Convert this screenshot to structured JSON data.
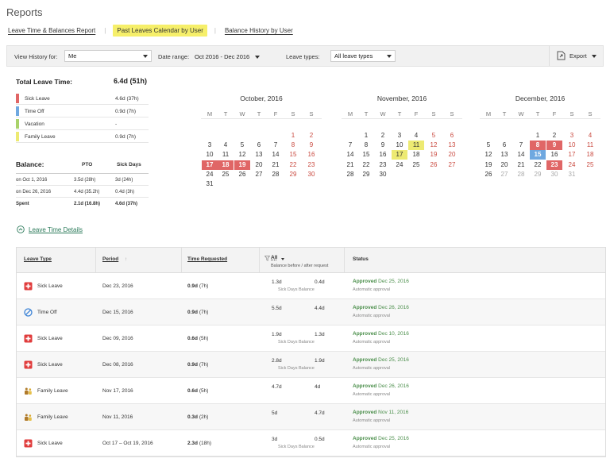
{
  "page_title": "Reports",
  "report_tabs": [
    {
      "label": "Leave Time & Balances Report"
    },
    {
      "label": "Past Leaves Calendar by User"
    },
    {
      "label": "Balance History by User"
    }
  ],
  "filters": {
    "view_history_label": "View History for:",
    "view_history_value": "Me",
    "date_range_label": "Date range:",
    "date_range_value": "Oct 2016 - Dec 2016",
    "leave_types_label": "Leave types:",
    "leave_types_value": "All leave types",
    "export_label": "Export"
  },
  "summary": {
    "total_label": "Total Leave Time:",
    "total_value": "6.4d (51h)",
    "legend": [
      {
        "name": "Sick Leave",
        "value": "4.6d (37h)",
        "color": "#e06666"
      },
      {
        "name": "Time Off",
        "value": "0.9d (7h)",
        "color": "#6fa8e0"
      },
      {
        "name": "Vacation",
        "value": "-",
        "color": "#a9d26a"
      },
      {
        "name": "Family Leave",
        "value": "0.9d (7h)",
        "color": "#edea72"
      }
    ]
  },
  "balance": {
    "title": "Balance:",
    "col1": "PTO",
    "col2": "Sick Days",
    "rows": [
      {
        "label": "on Oct 1, 2016",
        "pto": "3.5d (28h)",
        "sick": "3d (24h)"
      },
      {
        "label": "on Dec 26, 2016",
        "pto": "4.4d (35.2h)",
        "sick": "0.4d (3h)"
      },
      {
        "label": "Spent",
        "pto": "2.1d (16.8h)",
        "sick": "4.6d (37h)"
      }
    ]
  },
  "weekdays": [
    "M",
    "T",
    "W",
    "T",
    "F",
    "S",
    "S"
  ],
  "calendars": [
    {
      "title": "October, 2016",
      "weeks": [
        [
          "",
          "",
          "",
          "",
          "",
          "1",
          "2"
        ],
        [
          "3",
          "4",
          "5",
          "6",
          "7",
          "8",
          "9"
        ],
        [
          "10",
          "11",
          "12",
          "13",
          "14",
          "15",
          "16"
        ],
        [
          "17",
          "18",
          "19",
          "20",
          "21",
          "22",
          "23"
        ],
        [
          "24",
          "25",
          "26",
          "27",
          "28",
          "29",
          "30"
        ],
        [
          "31",
          "",
          "",
          "",
          "",
          "",
          ""
        ]
      ],
      "marked": {
        "17": "sick",
        "18": "sick",
        "19": "sick"
      },
      "muted": []
    },
    {
      "title": "November, 2016",
      "weeks": [
        [
          "",
          "1",
          "2",
          "3",
          "4",
          "5",
          "6"
        ],
        [
          "7",
          "8",
          "9",
          "10",
          "11",
          "12",
          "13"
        ],
        [
          "14",
          "15",
          "16",
          "17",
          "18",
          "19",
          "20"
        ],
        [
          "21",
          "22",
          "23",
          "24",
          "25",
          "26",
          "27"
        ],
        [
          "28",
          "29",
          "30",
          "",
          "",
          "",
          ""
        ]
      ],
      "marked": {
        "11": "family",
        "17": "family"
      },
      "muted": []
    },
    {
      "title": "December, 2016",
      "weeks": [
        [
          "",
          "",
          "",
          "1",
          "2",
          "3",
          "4"
        ],
        [
          "5",
          "6",
          "7",
          "8",
          "9",
          "10",
          "11"
        ],
        [
          "12",
          "13",
          "14",
          "15",
          "16",
          "17",
          "18"
        ],
        [
          "19",
          "20",
          "21",
          "22",
          "23",
          "24",
          "25"
        ],
        [
          "26",
          "27",
          "28",
          "29",
          "30",
          "31",
          ""
        ]
      ],
      "marked": {
        "8": "sick",
        "9": "sick",
        "15": "off",
        "23": "sick"
      },
      "muted": [
        "27",
        "28",
        "29",
        "30",
        "31"
      ]
    }
  ],
  "details_link": "Leave Time Details",
  "table": {
    "headers": {
      "leave_type": "Leave Type",
      "period": "Period",
      "period_sort": "↑",
      "time_requested": "Time Requested",
      "filter": "All",
      "balance_caption": "Balance before / after request",
      "status": "Status"
    },
    "rows": [
      {
        "icon": "sick-leave-icon",
        "type": "Sick Leave",
        "period": "Dec 23, 2016",
        "time_bold": "0.9d",
        "time_light": "(7h)",
        "before": "1.3d",
        "after": "0.4d",
        "balance_caption": "Sick Days Balance",
        "status": "Approved",
        "status_date": "Dec 25, 2016",
        "status_sub": "Automatic approval"
      },
      {
        "icon": "time-off-icon",
        "type": "Time Off",
        "period": "Dec 15, 2016",
        "time_bold": "0.9d",
        "time_light": "(7h)",
        "before": "5.5d",
        "after": "4.4d",
        "balance_caption": "",
        "status": "Approved",
        "status_date": "Dec 26, 2016",
        "status_sub": "Automatic approval"
      },
      {
        "icon": "sick-leave-icon",
        "type": "Sick Leave",
        "period": "Dec 09, 2016",
        "time_bold": "0.6d",
        "time_light": "(5h)",
        "before": "1.9d",
        "after": "1.3d",
        "balance_caption": "Sick Days Balance",
        "status": "Approved",
        "status_date": "Dec 10, 2016",
        "status_sub": "Automatic approval"
      },
      {
        "icon": "sick-leave-icon",
        "type": "Sick Leave",
        "period": "Dec 08, 2016",
        "time_bold": "0.9d",
        "time_light": "(7h)",
        "before": "2.8d",
        "after": "1.9d",
        "balance_caption": "Sick Days Balance",
        "status": "Approved",
        "status_date": "Dec 25, 2016",
        "status_sub": "Automatic approval"
      },
      {
        "icon": "family-leave-icon",
        "type": "Family Leave",
        "period": "Nov 17, 2016",
        "time_bold": "0.6d",
        "time_light": "(5h)",
        "before": "4.7d",
        "after": "4d",
        "balance_caption": "",
        "status": "Approved",
        "status_date": "Dec 26, 2016",
        "status_sub": "Automatic approval"
      },
      {
        "icon": "family-leave-icon",
        "type": "Family Leave",
        "period": "Nov 11, 2016",
        "time_bold": "0.3d",
        "time_light": "(2h)",
        "before": "5d",
        "after": "4.7d",
        "balance_caption": "",
        "status": "Approved",
        "status_date": "Nov 11, 2016",
        "status_sub": "Automatic approval"
      },
      {
        "icon": "sick-leave-icon",
        "type": "Sick Leave",
        "period": "Oct 17 – Oct 19, 2016",
        "time_bold": "2.3d",
        "time_light": "(18h)",
        "before": "3d",
        "after": "0.5d",
        "balance_caption": "Sick Days Balance",
        "status": "Approved",
        "status_date": "Dec 25, 2016",
        "status_sub": "Automatic approval"
      }
    ]
  }
}
